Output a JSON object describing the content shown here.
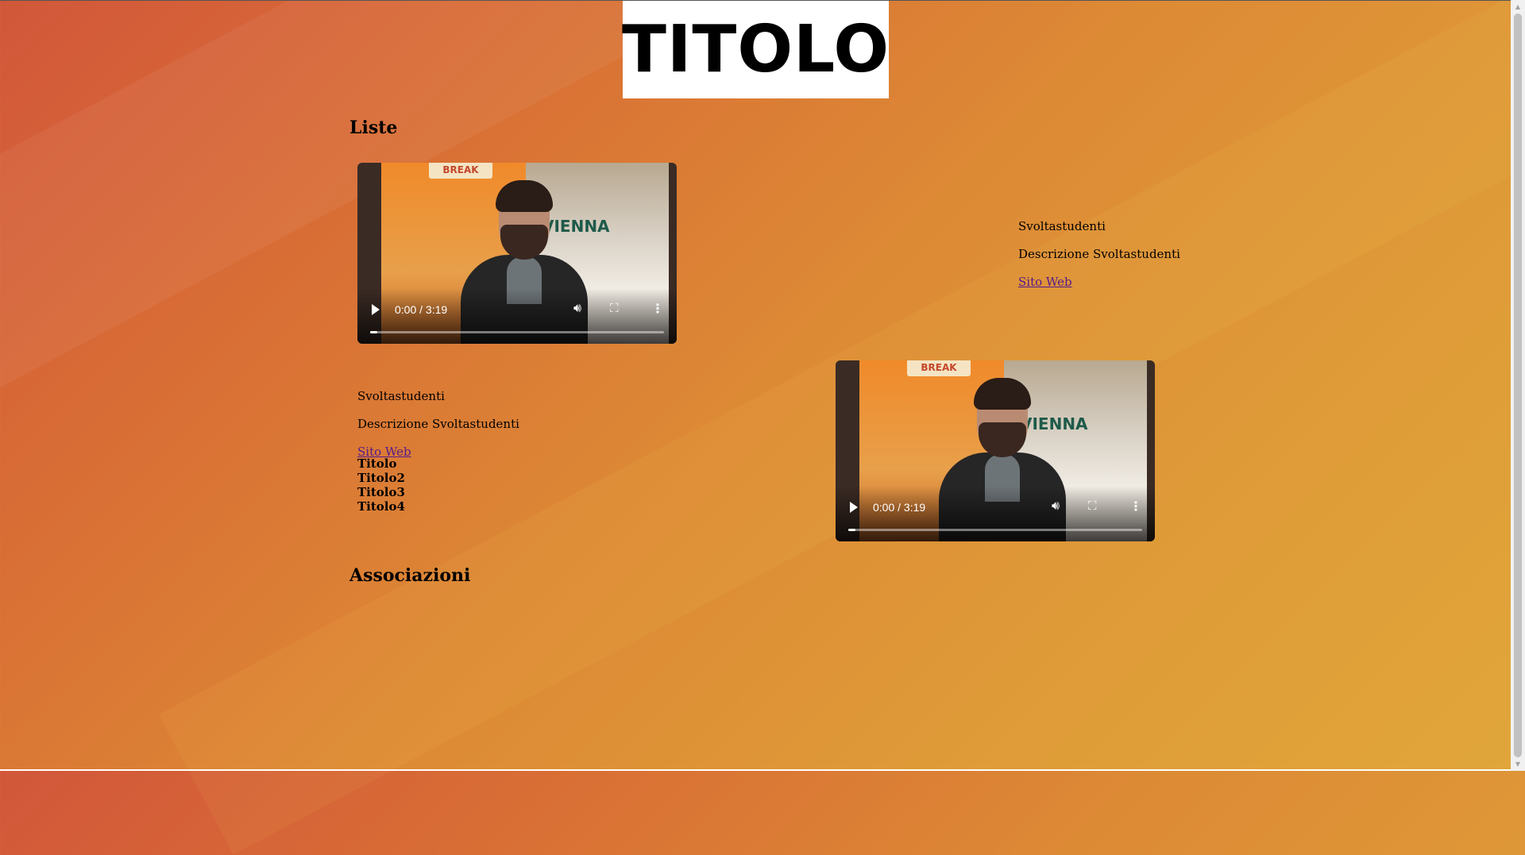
{
  "header": {
    "logo_text": "TITOLO"
  },
  "sections": {
    "liste_heading": "Liste",
    "associazioni_heading": "Associazioni"
  },
  "video1": {
    "time": "0:00 / 3:19",
    "progress": 0.02,
    "poster_title": "BREAK",
    "poster_city": "VIENNA"
  },
  "video2": {
    "time": "0:00 / 3:19",
    "progress": 0.02,
    "poster_title": "BREAK",
    "poster_city": "VIENNA"
  },
  "card1": {
    "name": "Svoltastudenti",
    "description": "Descrizione Svoltastudenti",
    "link": "Sito Web"
  },
  "card2": {
    "name": "Svoltastudenti",
    "description": "Descrizione Svoltastudenti",
    "link": "Sito Web"
  },
  "list": [
    "Titolo",
    "Titolo2",
    "Titolo3",
    "Titolo4"
  ],
  "colors": {
    "background_start": "#d2573a",
    "background_end": "#e0a63a",
    "link": "#551a8b"
  }
}
